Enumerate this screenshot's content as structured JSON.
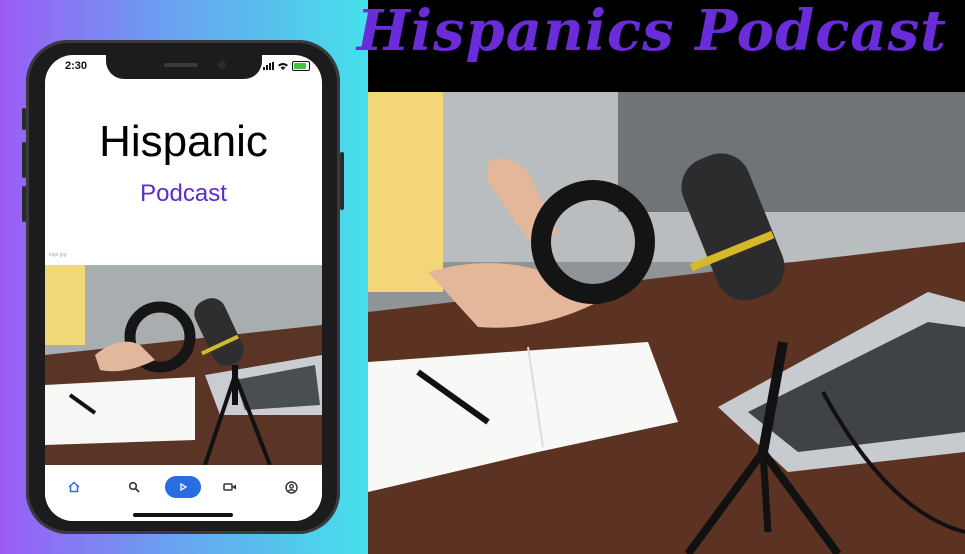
{
  "banner": {
    "title": "Hispanics Podcast"
  },
  "phone": {
    "status_time": "2:30",
    "app_title": "Hispanic",
    "app_subtitle": "Podcast",
    "image_caption": "logo.jpg",
    "nav": [
      {
        "icon": "home-icon",
        "active": true
      },
      {
        "icon": "search-icon",
        "active": false
      },
      {
        "icon": "play-icon",
        "active": true
      },
      {
        "icon": "video-icon",
        "active": false
      },
      {
        "icon": "account-icon",
        "active": false
      }
    ]
  },
  "colors": {
    "accent": "#5b2bd2",
    "title_purple": "#6a2cd9",
    "nav_blue": "#2a6de0",
    "gradient_start": "#9b5cf6",
    "gradient_end": "#45e0ea"
  }
}
